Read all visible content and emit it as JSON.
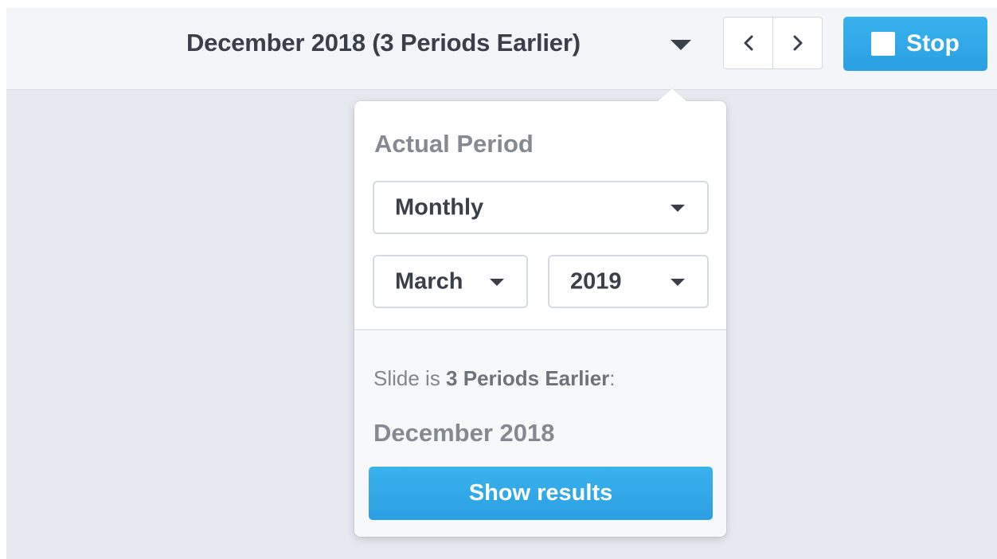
{
  "header": {
    "period_title": "December 2018 (3 Periods Earlier)",
    "prev_icon": "chevron-left-icon",
    "next_icon": "chevron-right-icon",
    "stop_label": "Stop",
    "stop_icon": "stop-square-icon",
    "accent_color": "#2fa8e8"
  },
  "popover": {
    "section_label": "Actual Period",
    "period_type": {
      "selected": "Monthly"
    },
    "month": {
      "selected": "March"
    },
    "year": {
      "selected": "2019"
    },
    "slide_prefix": "Slide is ",
    "slide_offset": "3 Periods Earlier",
    "slide_suffix": ":",
    "result_date": "December 2018",
    "show_results_label": "Show results"
  }
}
